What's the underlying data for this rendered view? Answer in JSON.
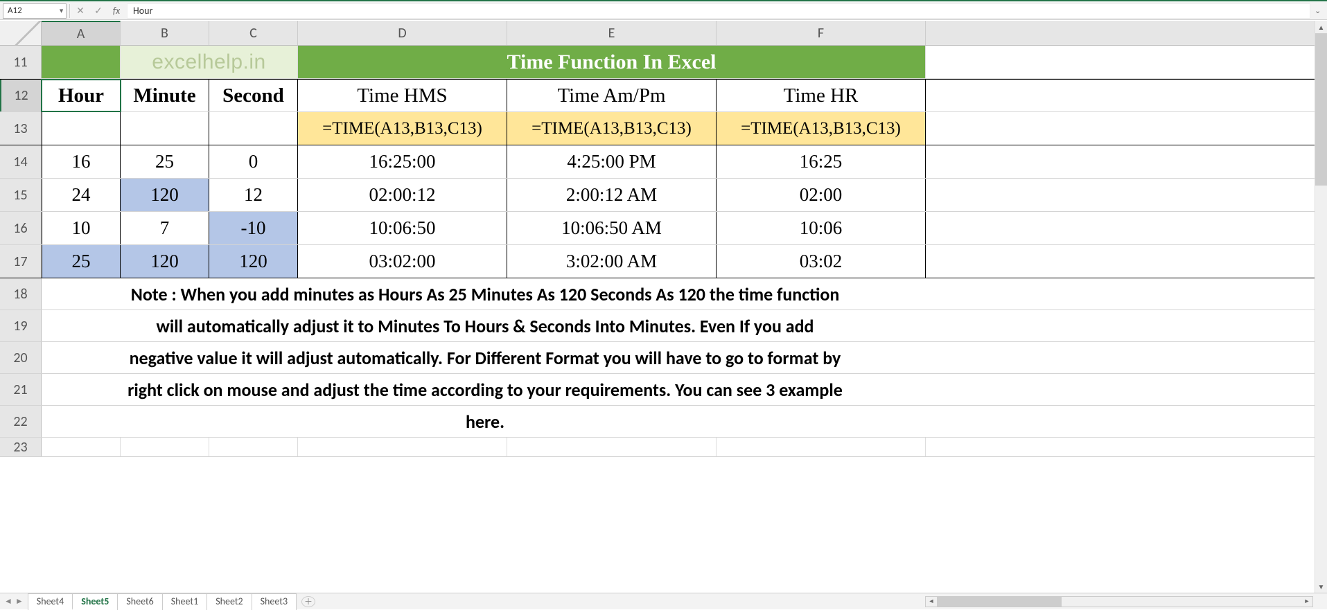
{
  "formula_bar": {
    "name_box": "A12",
    "fx_label": "fx",
    "formula": "Hour"
  },
  "columns": [
    "A",
    "B",
    "C",
    "D",
    "E",
    "F"
  ],
  "row_numbers": [
    "11",
    "12",
    "13",
    "14",
    "15",
    "16",
    "17",
    "18",
    "19",
    "20",
    "21",
    "22",
    "23"
  ],
  "active_cell": "A12",
  "title": {
    "logo": "excelhelp.in",
    "main": "Time Function In Excel"
  },
  "headers": {
    "A": "Hour",
    "B": "Minute",
    "C": "Second",
    "D": "Time HMS",
    "E": "Time Am/Pm",
    "F": "Time HR"
  },
  "formulas": {
    "D": "=TIME(A13,B13,C13)",
    "E": "=TIME(A13,B13,C13)",
    "F": "=TIME(A13,B13,C13)"
  },
  "data": [
    {
      "A": "16",
      "B": "25",
      "C": "0",
      "D": "16:25:00",
      "E": "4:25:00 PM",
      "F": "16:25",
      "hi": []
    },
    {
      "A": "24",
      "B": "120",
      "C": "12",
      "D": "02:00:12",
      "E": "2:00:12 AM",
      "F": "02:00",
      "hi": [
        "B"
      ]
    },
    {
      "A": "10",
      "B": "7",
      "C": "-10",
      "D": "10:06:50",
      "E": "10:06:50 AM",
      "F": "10:06",
      "hi": [
        "C"
      ]
    },
    {
      "A": "25",
      "B": "120",
      "C": "120",
      "D": "03:02:00",
      "E": "3:02:00 AM",
      "F": "03:02",
      "hi": [
        "A",
        "B",
        "C"
      ]
    }
  ],
  "note_lines": [
    "Note : When you add minutes as Hours As 25 Minutes As 120  Seconds As 120 the time function",
    "will automatically adjust it to Minutes To Hours & Seconds Into Minutes. Even If you add",
    "negative value it will adjust automatically.  For Different Format you will have to go to format by",
    "right click on mouse and adjust the time according to your requirements. You can see 3 example",
    "here."
  ],
  "sheet_tabs": {
    "tabs": [
      "Sheet4",
      "Sheet5",
      "Sheet6",
      "Sheet1",
      "Sheet2",
      "Sheet3"
    ],
    "active": "Sheet5"
  },
  "chart_data": {
    "type": "table",
    "title": "Time Function In Excel",
    "columns": [
      "Hour",
      "Minute",
      "Second",
      "Time HMS",
      "Time Am/Pm",
      "Time HR"
    ],
    "rows": [
      [
        16,
        25,
        0,
        "16:25:00",
        "4:25:00 PM",
        "16:25"
      ],
      [
        24,
        120,
        12,
        "02:00:12",
        "2:00:12 AM",
        "02:00"
      ],
      [
        10,
        7,
        -10,
        "10:06:50",
        "10:06:50 AM",
        "10:06"
      ],
      [
        25,
        120,
        120,
        "03:02:00",
        "3:02:00 AM",
        "03:02"
      ]
    ]
  }
}
